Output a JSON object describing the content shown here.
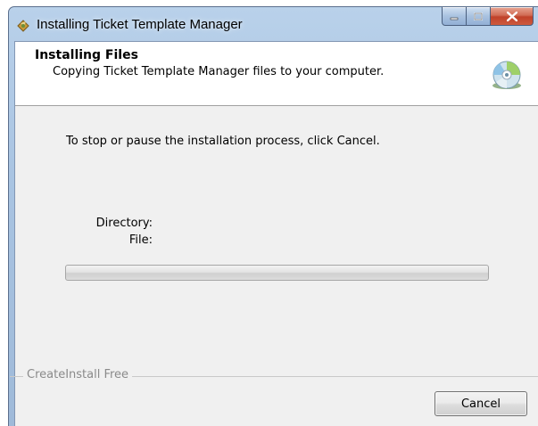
{
  "window": {
    "title": "Installing Ticket Template Manager",
    "caption_buttons": {
      "minimize_icon": "minimize-icon",
      "maximize_icon": "maximize-icon",
      "close_icon": "close-icon"
    }
  },
  "header": {
    "title": "Installing Files",
    "subtitle": "Copying Ticket Template Manager files to your computer.",
    "icon": "cd-disc-icon"
  },
  "body": {
    "instruction": "To stop or pause the installation process, click Cancel.",
    "directory_label": "Directory:",
    "directory_value": "",
    "file_label": "File:",
    "file_value": "",
    "progress_percent": 0
  },
  "footer": {
    "group_label": "CreateInstall Free",
    "cancel_label": "Cancel"
  },
  "colors": {
    "title_bar": "#b9d1ea",
    "dialog_background": "#f0f0f0",
    "header_background": "#ffffff",
    "close_button": "#c9523a",
    "progress_fill": "#06b025"
  }
}
